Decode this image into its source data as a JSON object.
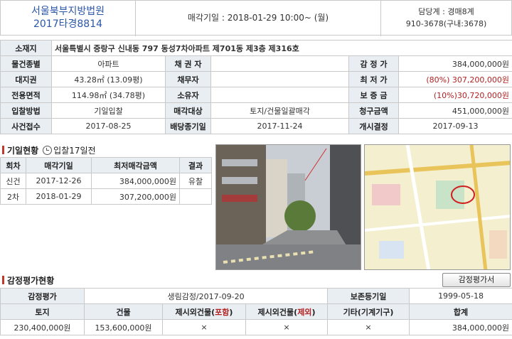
{
  "header": {
    "court": "서울북부지방법원",
    "case_no": "2017타경8814",
    "sale_date": "매각기일 : 2018-01-29   10:00~ (월)",
    "staff": "담당계 : 경매8계",
    "phone": "910-3678(구내:3678)"
  },
  "summary": {
    "address_label": "소재지",
    "address": "서울특별시 중랑구 신내동 797 동성7차아파트 제701동 제3층 제316호",
    "rows": [
      [
        "물건종별",
        "아파트",
        "채 권 자",
        "",
        "감 정 가",
        "384,000,000원"
      ],
      [
        "대지권",
        "43.28㎡ (13.09평)",
        "채무자",
        "",
        "최 저 가",
        "(80%) 307,200,000원"
      ],
      [
        "전용면적",
        "114.98㎡ (34.78평)",
        "소유자",
        "",
        "보 증 금",
        "(10%)30,720,000원"
      ],
      [
        "입찰방법",
        "기일입찰",
        "매각대상",
        "토지/건물일괄매각",
        "청구금액",
        "451,000,000원"
      ],
      [
        "사건접수",
        "2017-08-25",
        "배당종기일",
        "2017-11-24",
        "개시결정",
        "2017-09-13"
      ]
    ]
  },
  "auction": {
    "title": "기일현황",
    "bid_info": "입찰17일전",
    "headers": [
      "회차",
      "매각기일",
      "최저매각금액",
      "결과"
    ],
    "rows": [
      [
        "신건",
        "2017-12-26",
        "384,000,000원",
        "유찰"
      ],
      [
        "2차",
        "2018-01-29",
        "307,200,000원",
        ""
      ]
    ]
  },
  "appraisal": {
    "title": "감정평가현황",
    "button": "감정평가서",
    "row1": [
      "감정평가",
      "생림감정/2017-09-20",
      "보존등기일",
      "1999-05-18"
    ],
    "headers": [
      "토지",
      "건물",
      "제시외건물",
      "포함",
      "제시외건물",
      "제외",
      "기타(기계기구)",
      "합계"
    ],
    "values": [
      "230,400,000원",
      "153,600,000원",
      "×",
      "×",
      "×",
      "384,000,000원"
    ]
  },
  "colors": {
    "accent": "#2a56a8",
    "label_bg": "#e9eef3",
    "emphasis": "#b22222"
  }
}
